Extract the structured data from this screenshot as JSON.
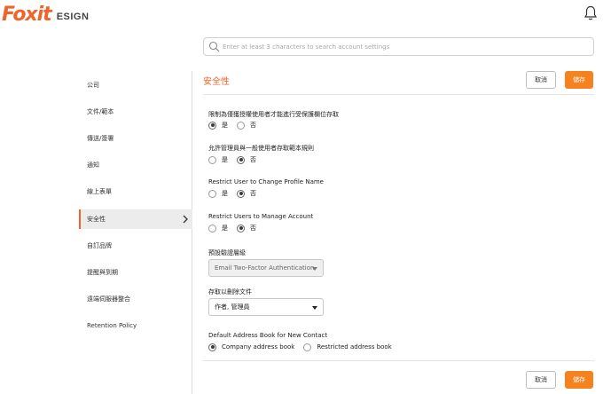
{
  "app": {
    "logo_text": "Foxit",
    "logo_product": "ESIGN"
  },
  "search": {
    "placeholder": "Enter at least 3 characters to search account settings"
  },
  "sidebar": {
    "items": [
      {
        "label": "公司"
      },
      {
        "label": "文件/範本"
      },
      {
        "label": "傳送/簽署"
      },
      {
        "label": "通知"
      },
      {
        "label": "線上表單"
      },
      {
        "label": "安全性",
        "active": true
      },
      {
        "label": "自訂品牌"
      },
      {
        "label": "提醒與到期"
      },
      {
        "label": "遠端伺服器整合"
      },
      {
        "label": "Retention Policy"
      }
    ]
  },
  "main": {
    "title": "安全性",
    "cancel_label": "取消",
    "save_label": "儲存",
    "settings": [
      {
        "label": "限制為僅獲授權使用者才能進行受保護欄位存取",
        "options": [
          "是",
          "否"
        ],
        "selected": "是"
      },
      {
        "label": "允許管理員與一般使用者存取範本規則",
        "options": [
          "是",
          "否"
        ],
        "selected": "否"
      },
      {
        "label": "Restrict User to Change Profile Name",
        "options": [
          "是",
          "否"
        ],
        "selected": "否"
      },
      {
        "label": "Restrict Users to Manage Account",
        "options": [
          "是",
          "否"
        ],
        "selected": "否"
      }
    ],
    "default_auth": {
      "label": "預設驗證層級",
      "value": "Email Two-Factor Authentication",
      "disabled": true
    },
    "delete_access": {
      "label": "存取以刪除文件",
      "value": "作者, 管理員"
    },
    "address_book": {
      "label": "Default Address Book for New Contact",
      "options": [
        "Company address book",
        "Restricted address book"
      ],
      "selected": "Company address book"
    }
  },
  "colors": {
    "brand": "#f0642a",
    "save_button": "#f6821f"
  },
  "icons": [
    "bell-icon",
    "search-icon",
    "chevron-right-icon"
  ]
}
